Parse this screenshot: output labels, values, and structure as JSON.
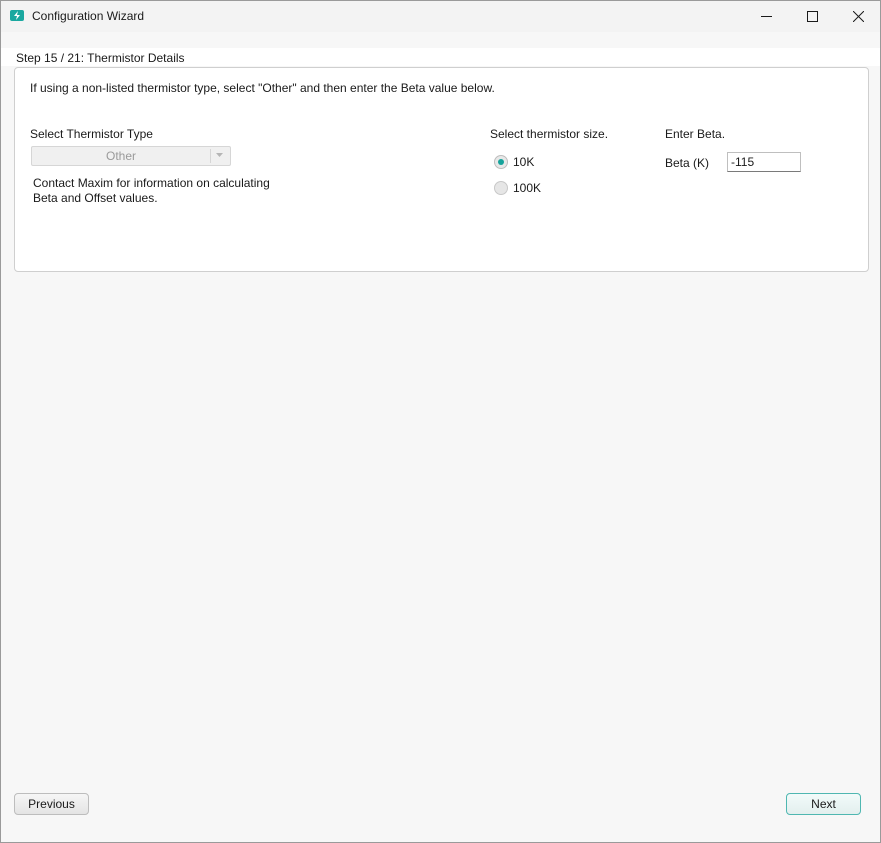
{
  "window": {
    "title": "Configuration Wizard",
    "accent_color": "#1aa8a0",
    "controls": [
      "minimize-icon",
      "maximize-icon",
      "close-icon"
    ]
  },
  "step": {
    "title": "Step 15 / 21: Thermistor Details"
  },
  "panel": {
    "instruction": "If using a non-listed thermistor type, select \"Other\" and then enter the Beta value below.",
    "thermistor_type": {
      "label": "Select Thermistor Type",
      "selected": "Other",
      "note_line1": "Contact Maxim for information on calculating",
      "note_line2": "Beta and Offset values."
    },
    "thermistor_size": {
      "label": "Select thermistor size.",
      "options": [
        {
          "label": "10K",
          "checked": true
        },
        {
          "label": "100K",
          "checked": false
        }
      ]
    },
    "beta": {
      "header": "Enter Beta.",
      "label": "Beta (K)",
      "value": "-115"
    }
  },
  "footer": {
    "previous_label": "Previous",
    "next_label": "Next"
  }
}
